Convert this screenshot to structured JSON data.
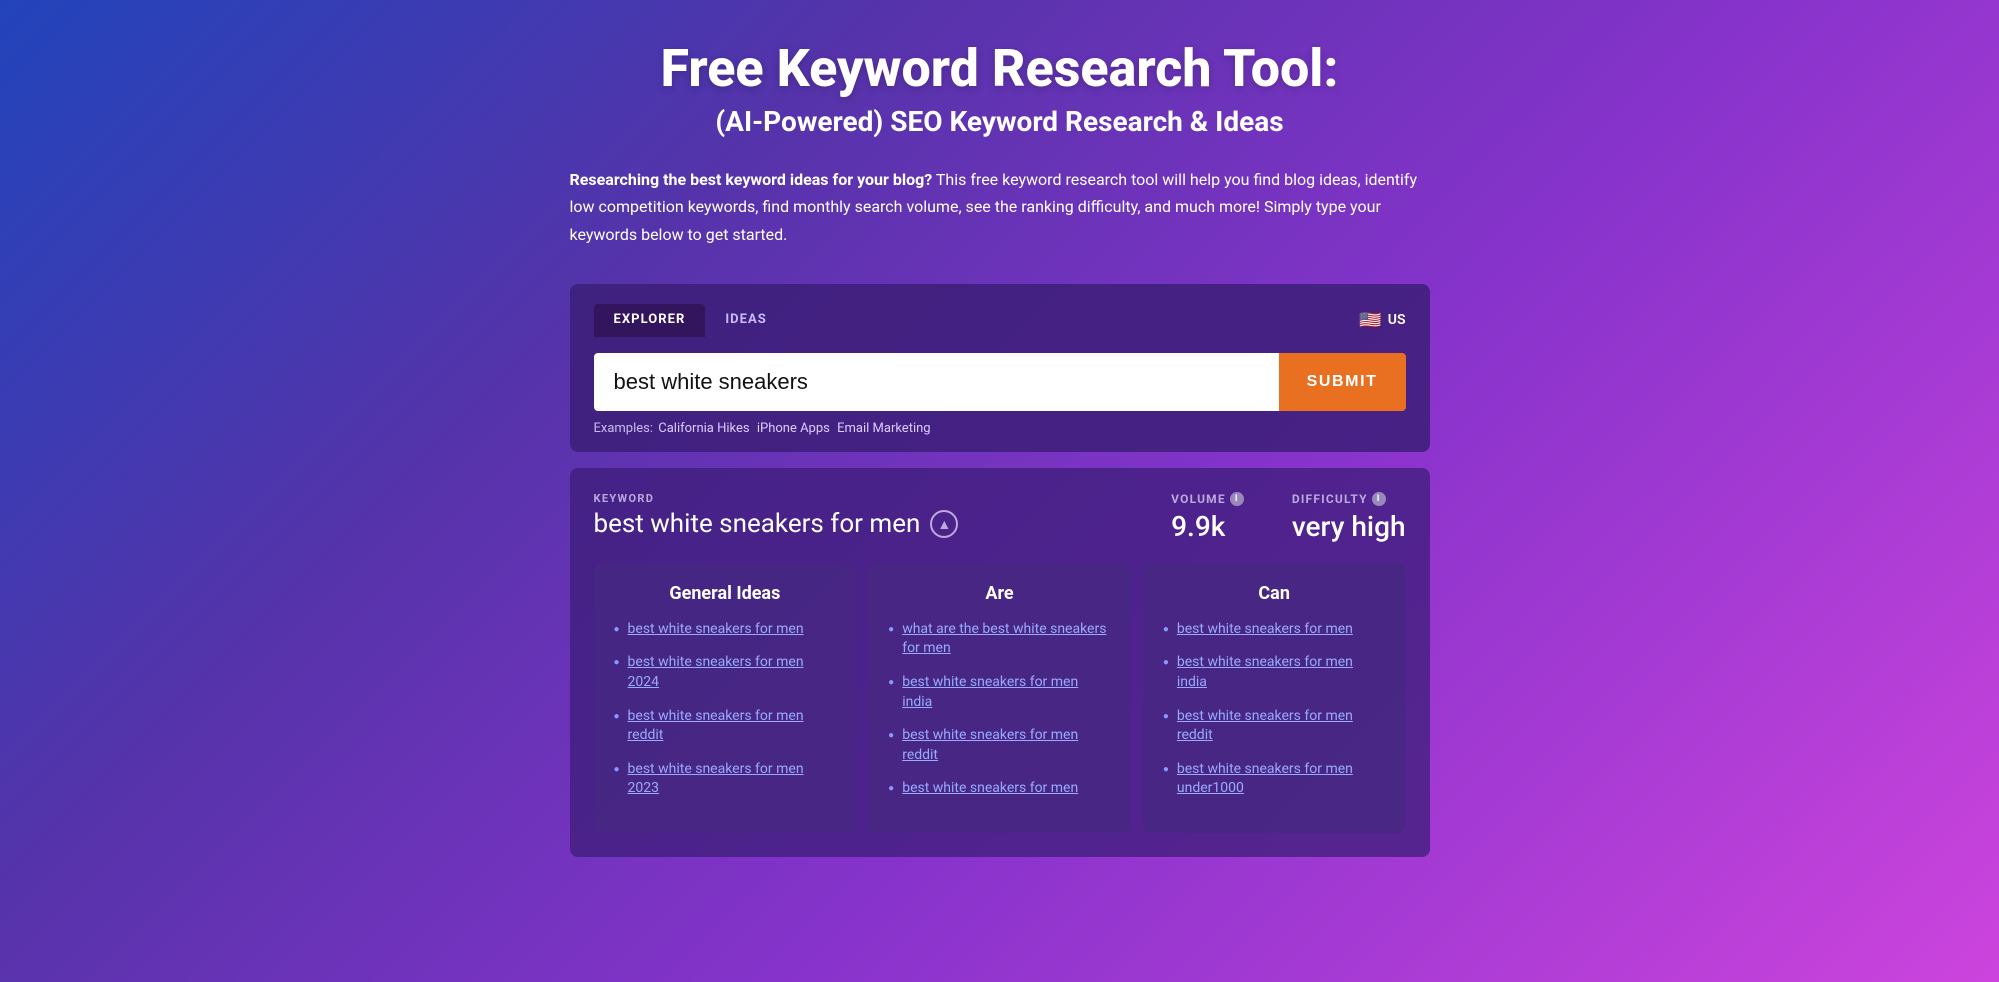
{
  "page": {
    "main_title": "Free Keyword Research Tool:",
    "sub_title": "(AI-Powered) SEO Keyword Research & Ideas",
    "description_bold": "Researching the best keyword ideas for your blog?",
    "description_text": " This free keyword research tool will help you find blog ideas, identify low competition keywords, find monthly search volume, see the ranking difficulty, and much more! Simply type your keywords below to get started."
  },
  "tabs": [
    {
      "label": "EXPLORER",
      "active": true
    },
    {
      "label": "IDEAS",
      "active": false
    }
  ],
  "country": {
    "flag": "🇺🇸",
    "code": "US"
  },
  "search": {
    "value": "best white sneakers",
    "placeholder": "Enter keyword...",
    "submit_label": "SUBMIT"
  },
  "examples": {
    "prefix": "Examples:",
    "items": [
      "California Hikes",
      "iPhone Apps",
      "Email Marketing"
    ]
  },
  "results": {
    "keyword_label": "KEYWORD",
    "keyword_value": "best white sneakers for men",
    "volume_label": "VOLUME",
    "volume_value": "9.9k",
    "difficulty_label": "DIFFICULTY",
    "difficulty_value": "very high",
    "ideas_sections": [
      {
        "title": "General Ideas",
        "items": [
          "best white sneakers for men",
          "best white sneakers for men 2024",
          "best white sneakers for men reddit",
          "best white sneakers for men 2023"
        ]
      },
      {
        "title": "Are",
        "items": [
          "what are the best white sneakers for men",
          "best white sneakers for men india",
          "best white sneakers for men reddit",
          "best white sneakers for men"
        ]
      },
      {
        "title": "Can",
        "items": [
          "best white sneakers for men",
          "best white sneakers for men india",
          "best white sneakers for men reddit",
          "best white sneakers for men under1000"
        ]
      }
    ]
  }
}
